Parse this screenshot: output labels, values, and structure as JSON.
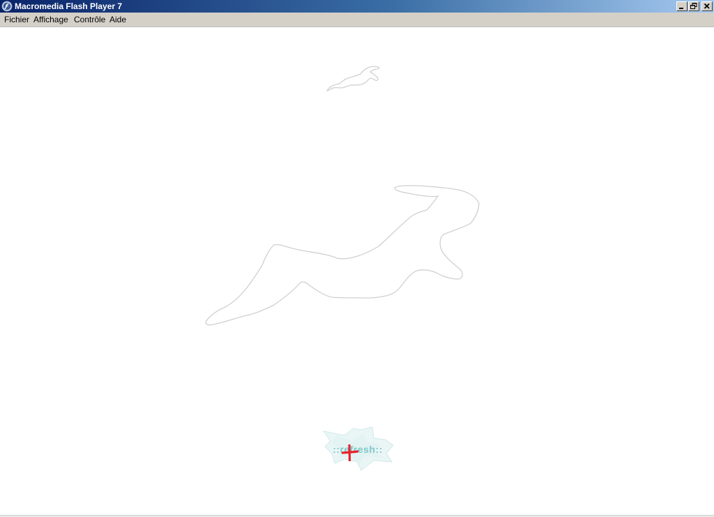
{
  "window": {
    "title": "Macromedia Flash Player 7",
    "controls": {
      "minimize_icon": "minimize-icon",
      "restore_icon": "restore-icon",
      "close_icon": "close-icon"
    }
  },
  "menubar": {
    "items": [
      {
        "label": "Fichier"
      },
      {
        "label": "Affichage"
      },
      {
        "label": "Contrôle"
      },
      {
        "label": "Aide"
      }
    ]
  },
  "stage": {
    "refresh_label": "::refresh::",
    "colors": {
      "outline": "#cfcfcf",
      "refresh_text": "#7ec7c9",
      "refresh_shape": "#e6f4f4",
      "cursor": "#e8202a"
    }
  },
  "colors": {
    "title_gradient_start": "#0a246a",
    "title_gradient_end": "#a6caf0",
    "chrome": "#d4d0c8"
  }
}
